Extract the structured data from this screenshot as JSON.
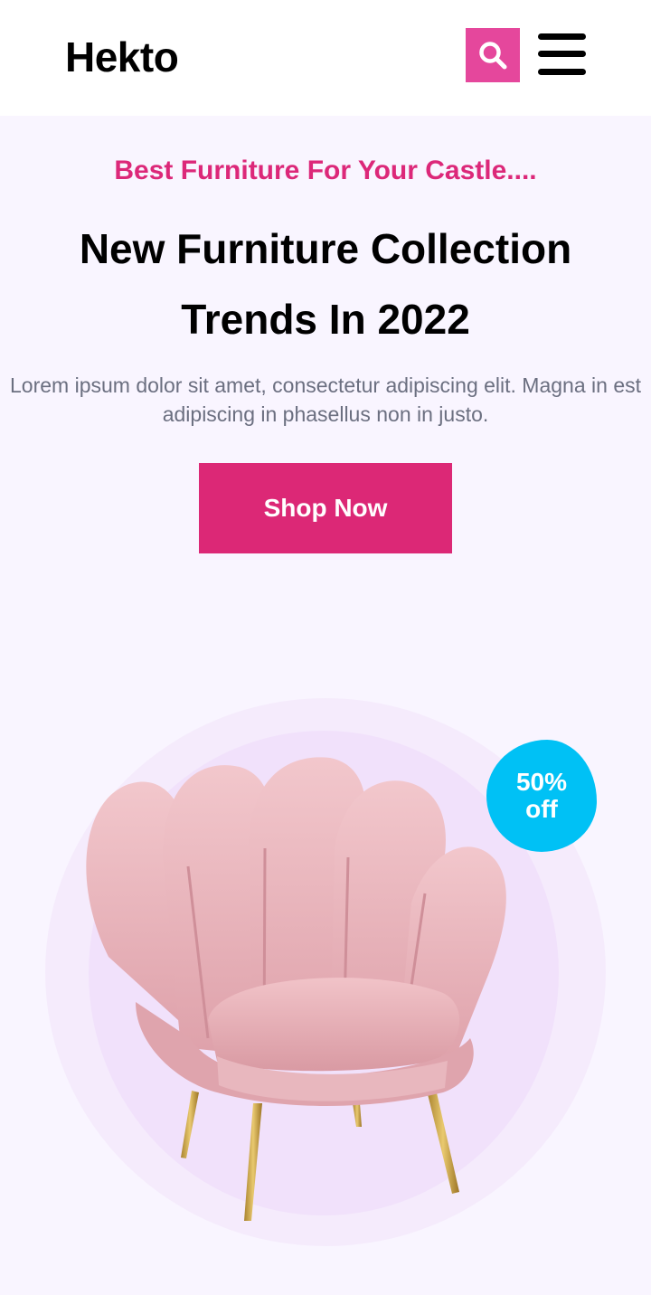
{
  "header": {
    "logo": "Hekto",
    "search_icon": "search-icon",
    "menu_icon": "hamburger-menu-icon"
  },
  "hero": {
    "tagline": "Best Furniture For Your Castle....",
    "headline_line1": "New Furniture Collection",
    "headline_line2": "Trends In 2022",
    "description": "Lorem ipsum dolor sit amet, consectetur adipiscing elit. Magna in est adipiscing in phasellus non in justo.",
    "cta_label": "Shop Now",
    "badge_line1": "50%",
    "badge_line2": "off"
  },
  "colors": {
    "accent_pink": "#DC2876",
    "search_pink": "#E5479C",
    "badge_blue": "#00C1F5",
    "hero_bg": "#F9F5FF",
    "chair_pink": "#E9B0B8"
  }
}
